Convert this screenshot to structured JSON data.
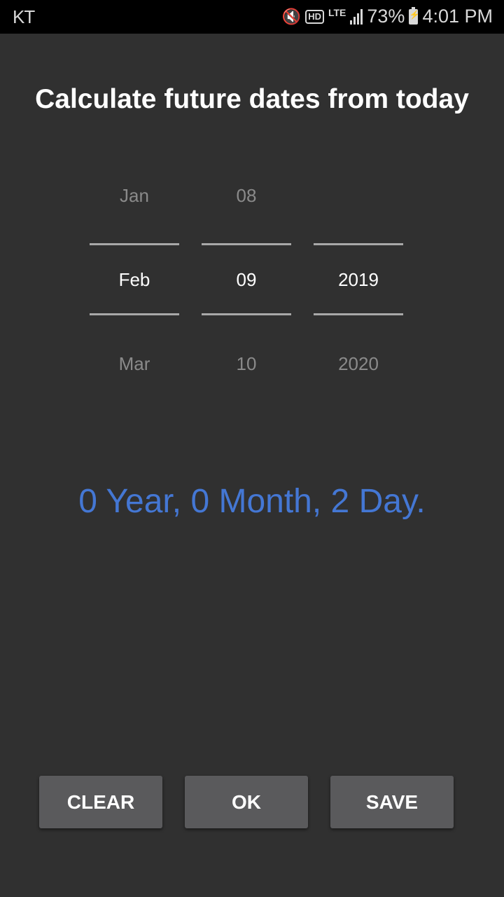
{
  "status_bar": {
    "carrier": "KT",
    "icons": [
      "mute-vibrate-icon",
      "hd-voice-icon",
      "lte-icon",
      "signal-icon",
      "battery-charging-icon"
    ],
    "hd_label": "HD",
    "lte_label": "LTE",
    "battery_percent": "73%",
    "time": "4:01 PM"
  },
  "title": "Calculate future dates from today",
  "picker": {
    "month": {
      "prev": "Jan",
      "selected": "Feb",
      "next": "Mar"
    },
    "day": {
      "prev": "08",
      "selected": "09",
      "next": "10"
    },
    "year": {
      "prev": "",
      "selected": "2019",
      "next": "2020"
    }
  },
  "result_text": "0 Year, 0 Month, 2 Day.",
  "buttons": {
    "clear": "CLEAR",
    "ok": "OK",
    "save": "SAVE"
  },
  "colors": {
    "background": "#303030",
    "accent": "#4477d4",
    "button": "#5a5a5c"
  }
}
